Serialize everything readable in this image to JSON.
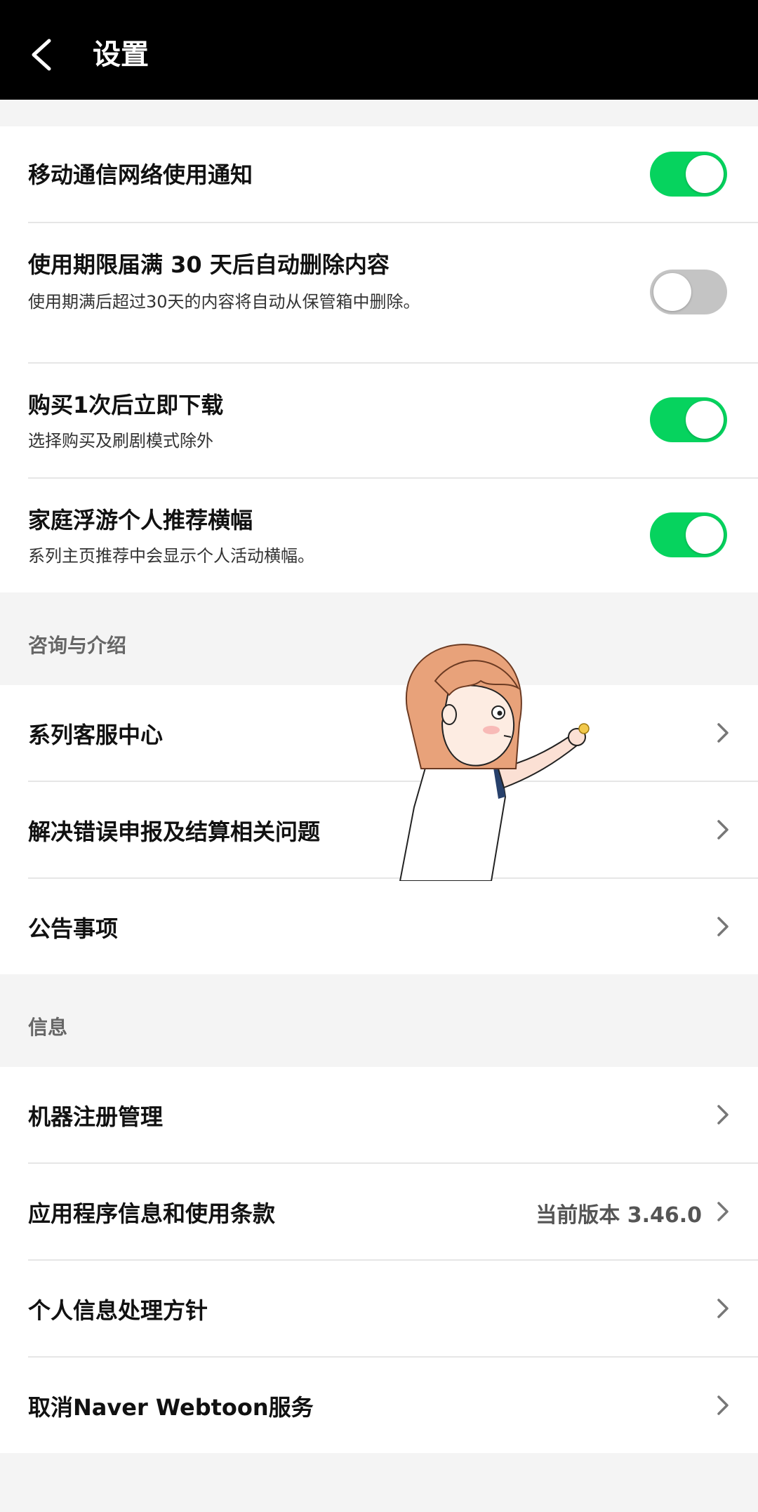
{
  "header": {
    "title": "设置",
    "back_icon": "back-arrow-icon"
  },
  "toggles": [
    {
      "label": "移动通信网络使用通知",
      "sub": "",
      "on": true
    },
    {
      "label": "使用期限届满 30 天后自动删除内容",
      "sub": "使用期满后超过30天的内容将自动从保管箱中删除。",
      "on": false
    },
    {
      "label": "购买1次后立即下载",
      "sub": "选择购买及刷剧模式除外",
      "on": true
    },
    {
      "label": "家庭浮游个人推荐横幅",
      "sub": "系列主页推荐中会显示个人活动横幅。",
      "on": true
    }
  ],
  "sections": {
    "inquiry": {
      "header": "咨询与介绍",
      "items": [
        {
          "label": "系列客服中心"
        },
        {
          "label": "解决错误申报及结算相关问题"
        },
        {
          "label": "公告事项"
        }
      ]
    },
    "info": {
      "header": "信息",
      "items": [
        {
          "label": "机器注册管理",
          "value": ""
        },
        {
          "label": "应用程序信息和使用条款",
          "value": "当前版本 3.46.0"
        },
        {
          "label": "个人信息处理方针",
          "value": ""
        },
        {
          "label": "取消Naver Webtoon服务",
          "value": ""
        }
      ]
    }
  },
  "colors": {
    "toggle_on": "#06d35e",
    "toggle_off": "#c4c4c4",
    "header_bg": "#000000"
  }
}
